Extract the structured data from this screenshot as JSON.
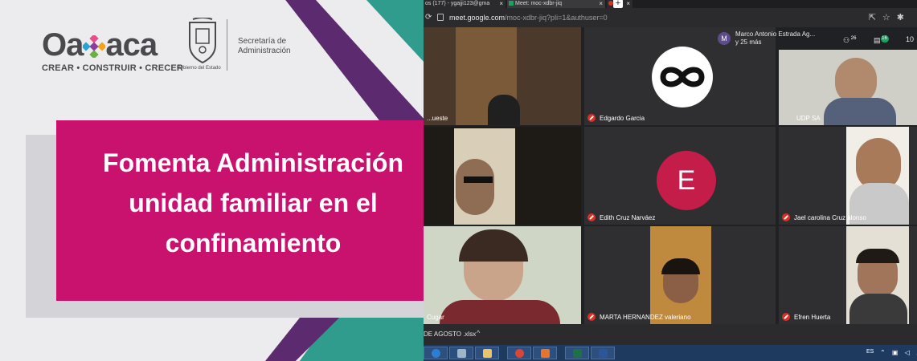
{
  "banner": {
    "logo": {
      "word": "Oaxaca",
      "word_start": "Oa",
      "word_end": "aca",
      "tagline": "CREAR • CONSTRUIR • CRECER",
      "seal_caption": "Gobierno del Estado",
      "secretaria_line1": "Secretaría de",
      "secretaria_line2": "Administración"
    },
    "headline": {
      "line1": "Fomenta Administración",
      "line2": "unidad familiar en el",
      "line3": "confinamiento"
    },
    "colors": {
      "pink": "#c8126e",
      "teal": "#2f9c8e",
      "purple": "#5c2a6e",
      "grey": "#ececee"
    }
  },
  "browser": {
    "tabs": [
      {
        "label": "os (177) - ygajji123@gma",
        "close": "×"
      },
      {
        "label": "Meet: moc-xdbr-jiq",
        "close": "×"
      },
      {
        "label": "",
        "close": "×"
      }
    ],
    "new_tab": "+",
    "reload_icon": "⟳",
    "url_host": "meet.google.com",
    "url_path": "/moc-xdbr-jiq?pli=1&authuser=0",
    "toolbar_icons": "⇱☆✱"
  },
  "meet": {
    "header": {
      "avatar_letter": "M",
      "presenter": "Marco Antonio Estrada Ag...",
      "others": "y 25 más",
      "participants_count": "26",
      "chat_count": "16",
      "clock_partial": "10"
    },
    "participants": [
      {
        "name": "...ueste",
        "muted": false
      },
      {
        "name": "Edgardo Garcia",
        "muted": true
      },
      {
        "name": "UDP SA",
        "muted": false
      },
      {
        "name": "",
        "muted": false
      },
      {
        "name": "Edith Cruz Narváez",
        "muted": true,
        "avatar_letter": "E"
      },
      {
        "name": "Jael carolina Cruz alonso",
        "muted": true
      },
      {
        "name": "Cugar",
        "muted": false
      },
      {
        "name": "MARTA HERNANDEZ valeriano",
        "muted": true
      },
      {
        "name": "Efren Huerta",
        "muted": true
      }
    ]
  },
  "downloads": {
    "file": "DE AGOSTO .xlsx",
    "chevron": "^"
  },
  "taskbar": {
    "lang": "ES",
    "tray": "⌃ ▣ ◁ 🔈"
  }
}
